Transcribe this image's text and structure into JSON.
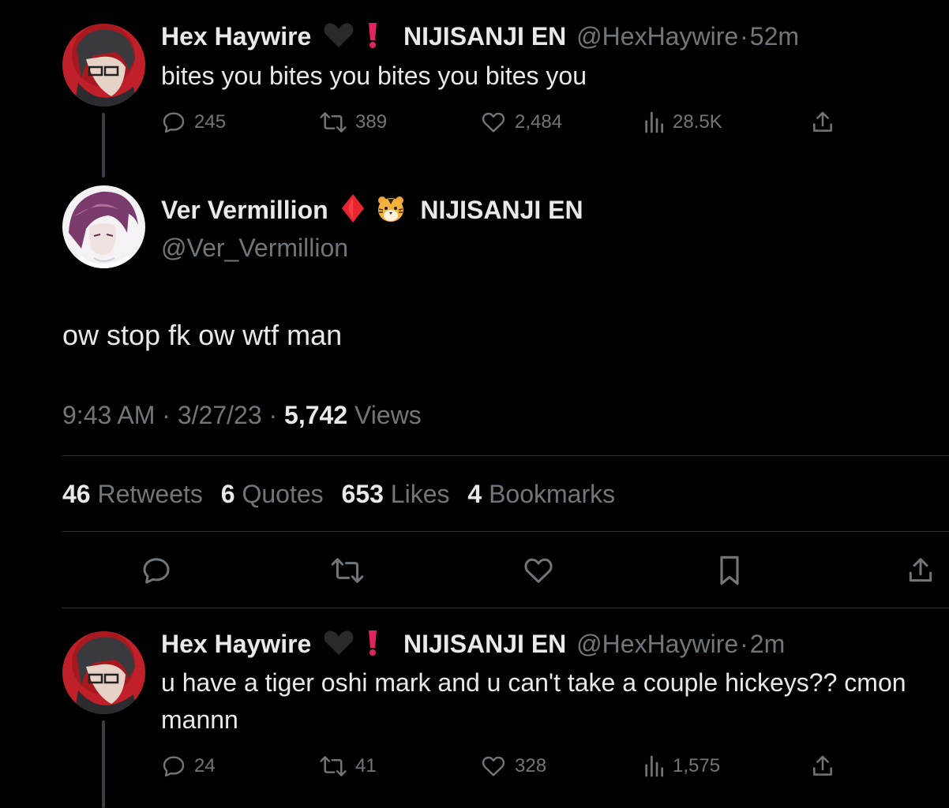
{
  "tweets_above": {
    "name": "Hex Haywire",
    "affiliation": "NIJISANJI EN",
    "handle": "@HexHaywire",
    "time": "52m",
    "text": "bites you bites you bites you bites you",
    "replies": "245",
    "retweets": "389",
    "likes": "2,484",
    "views": "28.5K"
  },
  "main_tweet": {
    "name": "Ver Vermillion",
    "affiliation": "NIJISANJI EN",
    "handle": "@Ver_Vermillion",
    "text": "ow stop fk ow wtf man",
    "time": "9:43 AM",
    "date": "3/27/23",
    "views_count": "5,742",
    "views_label": "Views",
    "stats": [
      {
        "n": "46",
        "label": "Retweets"
      },
      {
        "n": "6",
        "label": "Quotes"
      },
      {
        "n": "653",
        "label": "Likes"
      },
      {
        "n": "4",
        "label": "Bookmarks"
      }
    ]
  },
  "reply": {
    "name": "Hex Haywire",
    "affiliation": "NIJISANJI EN",
    "handle": "@HexHaywire",
    "time": "2m",
    "text_line1": "u have a tiger oshi mark and u can't take a couple hickeys?? cmon",
    "text_line2": "mannn",
    "replies": "24",
    "retweets": "41",
    "likes": "328",
    "views": "1,575"
  },
  "colors": {
    "background": "#000000",
    "text": "#e7e9ea",
    "muted": "#71767b",
    "divider": "#2f3336",
    "red_exclaim": "#e0245e",
    "red_diamond": "#e8262f"
  }
}
